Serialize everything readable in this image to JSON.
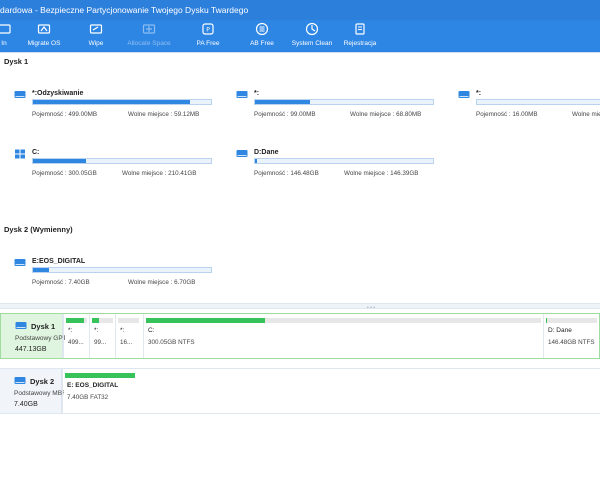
{
  "window": {
    "title": "dardowa - Bezpieczne Partycjonowanie Twojego Dysku Twardego"
  },
  "toolbar": {
    "items": [
      {
        "label": "In",
        "icon": "partial-icon",
        "disabled": false
      },
      {
        "label": "Migrate OS",
        "icon": "migrate-os-icon",
        "disabled": false
      },
      {
        "label": "Wipe",
        "icon": "wipe-icon",
        "disabled": false
      },
      {
        "label": "Allocate Space",
        "icon": "allocate-space-icon",
        "disabled": true
      },
      {
        "label": "PA Free",
        "icon": "pa-free-icon",
        "disabled": false
      },
      {
        "label": "AB Free",
        "icon": "ab-free-icon",
        "disabled": false
      },
      {
        "label": "System Clean",
        "icon": "system-clean-icon",
        "disabled": false
      },
      {
        "label": "Rejestracja",
        "icon": "registration-icon",
        "disabled": false
      }
    ]
  },
  "disk1_title": "Dysk 1",
  "disk2_title": "Dysk 2 (Wymienny)",
  "labels": {
    "capacity": "Pojemność :",
    "free": "Wolne miejsce :"
  },
  "disk1_partitions": [
    {
      "name": "*:Odzyskiwanie",
      "capacity": "499.00MB",
      "free": "59.12MB",
      "fill": 0.88,
      "icon": "drive-icon"
    },
    {
      "name": "*:",
      "capacity": "99.00MB",
      "free": "68.80MB",
      "fill": 0.31,
      "icon": "drive-icon"
    },
    {
      "name": "*:",
      "capacity": "16.00MB",
      "free": "",
      "fill": 0.0,
      "icon": "drive-icon"
    },
    {
      "name": "C:",
      "capacity": "300.05GB",
      "free": "210.41GB",
      "fill": 0.3,
      "icon": "windows-icon"
    },
    {
      "name": "D:Dane",
      "capacity": "146.48GB",
      "free": "146.39GB",
      "fill": 0.01,
      "icon": "drive-icon"
    }
  ],
  "disk2_partitions": [
    {
      "name": "E:EOS_DIGITAL",
      "capacity": "7.40GB",
      "free": "6.70GB",
      "fill": 0.09,
      "icon": "drive-icon"
    }
  ],
  "disk_map": [
    {
      "name": "Dysk 1",
      "type": "Podstawowy GPT",
      "size": "447.13GB",
      "selected": true,
      "segments": [
        {
          "name": "*:",
          "info": "499...",
          "fill": 0.88
        },
        {
          "name": "*:",
          "info": "99...",
          "fill": 0.31
        },
        {
          "name": "*:",
          "info": "16...",
          "fill": 0.0
        },
        {
          "name": "C:",
          "info": "300.05GB NTFS",
          "fill": 0.3
        },
        {
          "name": "D: Dane",
          "info": "146.48GB NTFS",
          "fill": 0.01
        }
      ]
    },
    {
      "name": "Dysk 2",
      "type": "Podstawowy MBR",
      "size": "7.40GB",
      "selected": false,
      "segments": [
        {
          "name": "E: EOS_DIGITAL",
          "info": "7.40GB FAT32",
          "fill": 0.09
        }
      ]
    }
  ],
  "colors": {
    "titlebar": "#2d7fdc",
    "toolbar": "#2e86e4",
    "usage_bar": "#2f87e2",
    "map_bar": "#37c25a",
    "selected_row": "#dff5df"
  }
}
